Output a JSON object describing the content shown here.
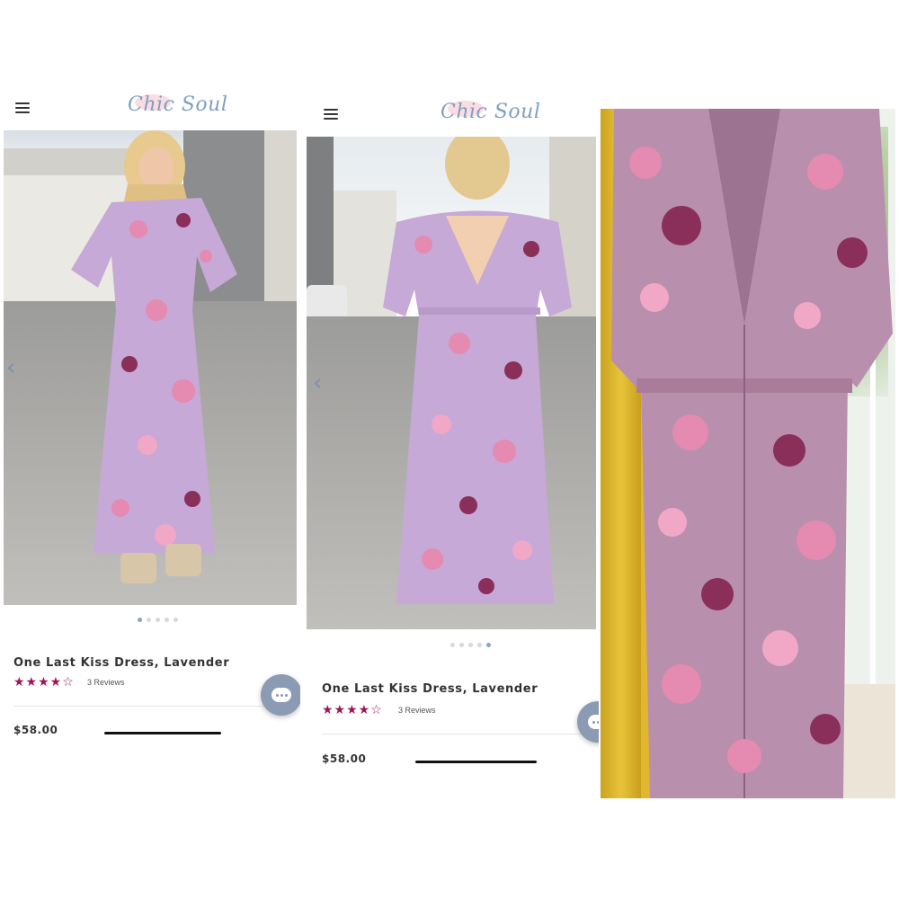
{
  "brand": {
    "logo_text": "Chic Soul"
  },
  "screens": [
    {
      "product_title": "One Last Kiss Dress, Lavender",
      "rating_stars": "★★★★☆",
      "reviews_label": "3 Reviews",
      "price": "$58.00",
      "carousel_active_index": 0,
      "carousel_count": 5
    },
    {
      "product_title": "One Last Kiss Dress, Lavender",
      "rating_stars": "★★★★☆",
      "reviews_label": "3 Reviews",
      "price": "$58.00",
      "carousel_active_index": 4,
      "carousel_count": 5
    }
  ],
  "icons": {
    "menu": "hamburger-icon",
    "prev": "chevron-left-icon",
    "chat": "chat-bubble-icon"
  },
  "colors": {
    "accent_stars": "#a0145a",
    "logo": "#7f9fc2",
    "dress_lavender": "#c6a9d6",
    "flower_pink": "#e58ab0",
    "flower_plum": "#8a2e5a"
  },
  "rating_value": 4,
  "rating_max": 5
}
